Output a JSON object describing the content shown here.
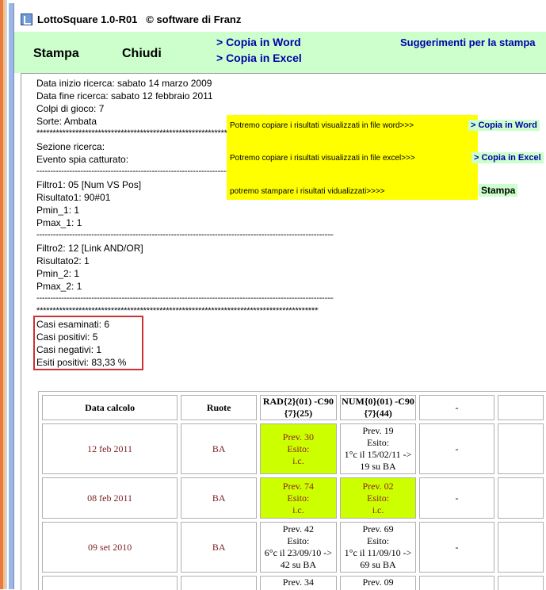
{
  "window": {
    "title": "LottoSquare 1.0-R01",
    "copyright": "© software di Franz"
  },
  "toolbar": {
    "print_label": "Stampa",
    "close_label": "Chiudi",
    "copy_word_label": "> Copia in Word",
    "copy_excel_label": "> Copia in Excel",
    "print_tips_label": "Suggerimenti per la stampa"
  },
  "report": {
    "lines": [
      "Data inizio ricerca: sabato 14 marzo 2009",
      "Data fine ricerca: sabato 12 febbraio 2011",
      "Colpi di gioco: 7",
      "Sorte: Ambata"
    ],
    "stars_short": "**********************************************************************",
    "section_lines": [
      "Sezione ricerca:",
      "Evento spia catturato:"
    ],
    "dash_line": "----------------------------------------------------------------------------------------------------------------------",
    "filter1": [
      "Filtro1: 05 [Num VS Pos]",
      "Risultato1: 90#01",
      "Pmin_1: 1",
      "Pmax_1: 1"
    ],
    "filter2": [
      "Filtro2: 12 [Link AND/OR]",
      "Risultato2: 1",
      "Pmin_2: 1",
      "Pmax_2: 1"
    ],
    "stars_long": "****************************************************************************************************",
    "summary": [
      "Casi esaminati: 6",
      "Casi positivi: 5",
      "Casi negativi: 1",
      "Esiti positivi: 83,33 %"
    ]
  },
  "tips": {
    "word_text": "Potremo copiare i risultati visualizzati in file word>>>",
    "word_button": "> Copia in Word",
    "excel_text": "Potremo copiare i risultati visualizzati in file excel>>>",
    "excel_button": "> Copia in Excel",
    "print_text": "potremo stampare i risultati vidualizzati>>>>",
    "print_button": "Stampa"
  },
  "table": {
    "headers": [
      "Data calcolo",
      "Ruote",
      "RAD{2}(01) -C90 {7}(25)",
      "NUM{0}(01) -C90 {7}(44)",
      "-"
    ],
    "rows": [
      {
        "date": "12 feb 2011",
        "wheel": "BA",
        "c1": {
          "lines": [
            "Prev. 30",
            "Esito:",
            "i.c."
          ],
          "hit": true
        },
        "c2": {
          "lines": [
            "Prev. 19",
            "Esito:",
            "1°c il 15/02/11 ->",
            "19 su BA"
          ],
          "hit": false
        },
        "c3": "-"
      },
      {
        "date": "08 feb 2011",
        "wheel": "BA",
        "c1": {
          "lines": [
            "Prev. 74",
            "Esito:",
            "i.c."
          ],
          "hit": true
        },
        "c2": {
          "lines": [
            "Prev. 02",
            "Esito:",
            "i.c."
          ],
          "hit": true
        },
        "c3": "-"
      },
      {
        "date": "09 set 2010",
        "wheel": "BA",
        "c1": {
          "lines": [
            "Prev. 42",
            "Esito:",
            "6°c il 23/09/10 ->",
            "42 su BA"
          ],
          "hit": false
        },
        "c2": {
          "lines": [
            "Prev. 69",
            "Esito:",
            "1°c il 11/09/10 ->",
            "69 su BA"
          ],
          "hit": false
        },
        "c3": "-"
      },
      {
        "date": "",
        "wheel": "",
        "c1": {
          "lines": [
            "Prev. 34"
          ],
          "hit": false
        },
        "c2": {
          "lines": [
            "Prev. 09"
          ],
          "hit": false
        },
        "c3": ""
      }
    ]
  },
  "colors": {
    "toolbar_bg": "#ccffcc",
    "link_blue": "#0000a8",
    "highlight_yellow": "#ffff00",
    "hit_green": "#ccff00",
    "summary_border": "#d03030"
  }
}
